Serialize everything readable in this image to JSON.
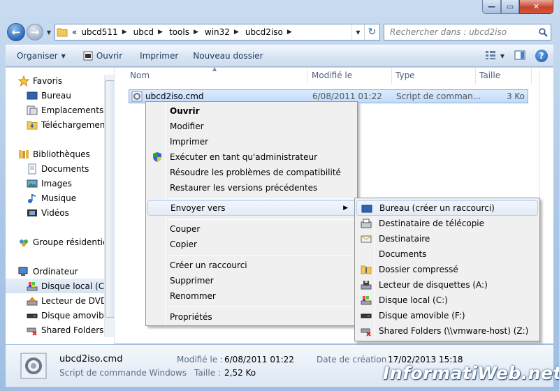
{
  "window": {
    "min_label": "—",
    "max_label": "▭",
    "close_label": "✕"
  },
  "address": {
    "prefix": "«",
    "segments": [
      "ubcd511",
      "ubcd",
      "tools",
      "win32",
      "ubcd2iso"
    ]
  },
  "search": {
    "placeholder": "Rechercher dans : ubcd2iso"
  },
  "toolbar": {
    "organize": "Organiser",
    "open": "Ouvrir",
    "print": "Imprimer",
    "new_folder": "Nouveau dossier"
  },
  "sidebar": {
    "favorites": "Favoris",
    "fav_items": [
      "Bureau",
      "Emplacements ré",
      "Téléchargements"
    ],
    "libraries": "Bibliothèques",
    "lib_items": [
      "Documents",
      "Images",
      "Musique",
      "Vidéos"
    ],
    "homegroup": "Groupe résidentiel",
    "computer": "Ordinateur",
    "comp_items": [
      "Disque local (C:)",
      "Lecteur de DVD (",
      "Disque amovible",
      "Shared Folders (\\"
    ]
  },
  "columns": {
    "name": "Nom",
    "modified": "Modifié le",
    "type": "Type",
    "size": "Taille"
  },
  "file": {
    "name": "ubcd2iso.cmd",
    "modified": "6/08/2011 01:22",
    "type": "Script de comman...",
    "size": "3 Ko"
  },
  "context_menu": {
    "open": "Ouvrir",
    "edit": "Modifier",
    "print": "Imprimer",
    "run_as_admin": "Exécuter en tant qu'administrateur",
    "troubleshoot": "Résoudre les problèmes de compatibilité",
    "restore": "Restaurer les versions précédentes",
    "send_to": "Envoyer vers",
    "cut": "Couper",
    "copy": "Copier",
    "create_shortcut": "Créer un raccourci",
    "delete": "Supprimer",
    "rename": "Renommer",
    "properties": "Propriétés"
  },
  "send_to_menu": [
    "Bureau (créer un raccourci)",
    "Destinataire de télécopie",
    "Destinataire",
    "Documents",
    "Dossier compressé",
    "Lecteur de disquettes (A:)",
    "Disque local (C:)",
    "Disque amovible (F:)",
    "Shared Folders (\\\\vmware-host) (Z:)"
  ],
  "details": {
    "name": "ubcd2iso.cmd",
    "type": "Script de commande Windows",
    "modified_label": "Modifié le :",
    "modified_value": "6/08/2011 01:22",
    "size_label": "Taille :",
    "size_value": "2,52 Ko",
    "created_label": "Date de création :",
    "created_value": "17/02/2013 15:18"
  },
  "watermark": "InformatiWeb.net"
}
